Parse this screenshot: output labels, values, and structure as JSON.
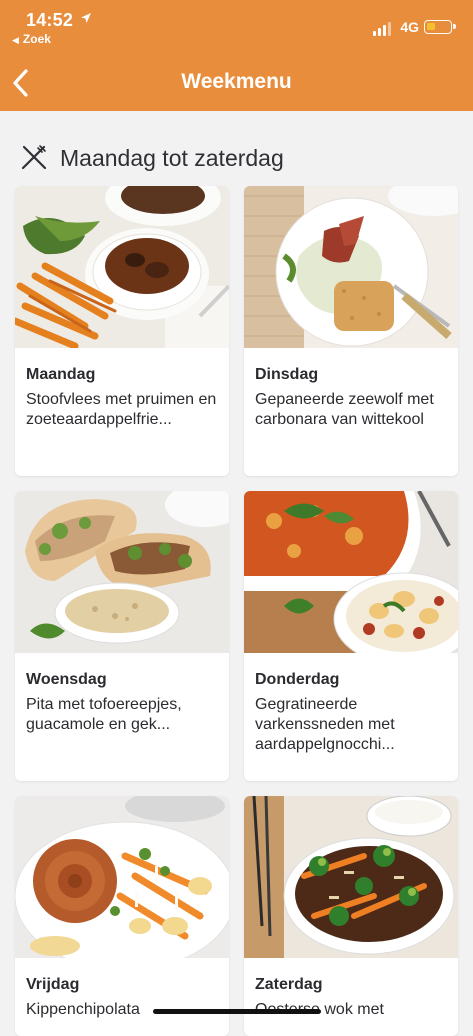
{
  "status_bar": {
    "time": "14:52",
    "back_app": "Zoek",
    "network": "4G"
  },
  "nav": {
    "title": "Weekmenu"
  },
  "section": {
    "title": "Maandag tot zaterdag"
  },
  "meals": [
    {
      "day": "Maandag",
      "description": "Stoofvlees met pruimen en zoeteaardappelfrie..."
    },
    {
      "day": "Dinsdag",
      "description": "Gepaneerde zeewolf met carbonara van wittekool"
    },
    {
      "day": "Woensdag",
      "description": "Pita met tofoereepjes, guacamole en gek..."
    },
    {
      "day": "Donderdag",
      "description": "Gegratineerde varkenssneden met aardappelgnocchi..."
    },
    {
      "day": "Vrijdag",
      "description": "Kippenchipolata"
    },
    {
      "day": "Zaterdag",
      "description": "Oosterse wok met"
    }
  ],
  "colors": {
    "accent": "#e88d3c",
    "background": "#f2f2f3",
    "text": "#2b2b30"
  }
}
